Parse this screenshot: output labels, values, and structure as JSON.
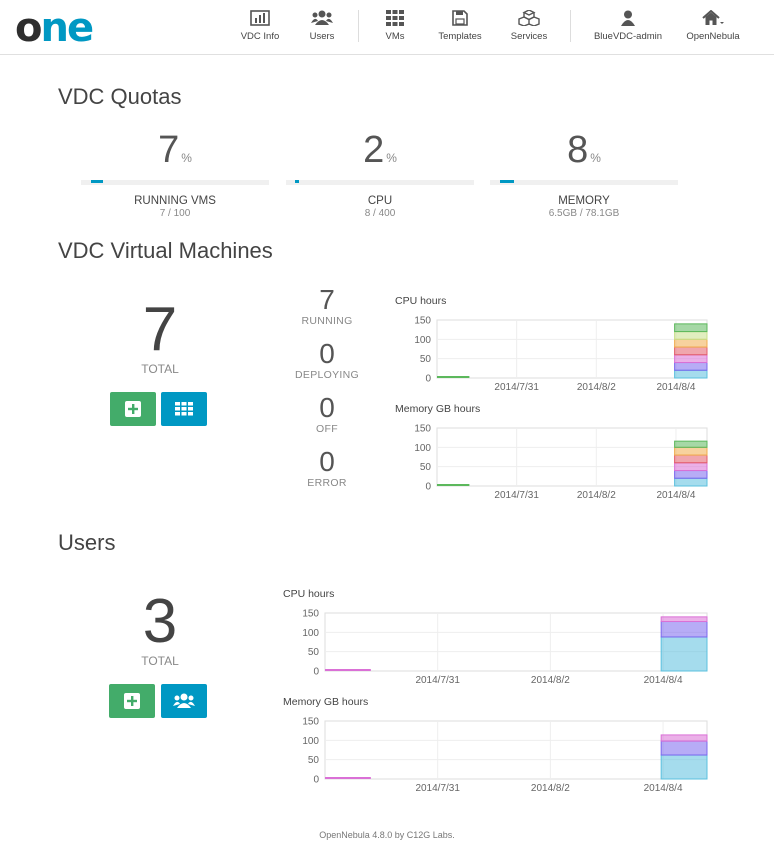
{
  "header": {
    "logo_o": "o",
    "logo_ne": "ne",
    "nav": [
      {
        "label": "VDC Info",
        "icon": "bar-chart-icon"
      },
      {
        "label": "Users",
        "icon": "users-icon"
      },
      {
        "label": "VMs",
        "icon": "grid-icon"
      },
      {
        "label": "Templates",
        "icon": "save-icon"
      },
      {
        "label": "Services",
        "icon": "cubes-icon"
      },
      {
        "label": "BlueVDC-admin",
        "icon": "user-icon"
      },
      {
        "label": "OpenNebula",
        "icon": "home-icon"
      }
    ]
  },
  "quotas": {
    "title": "VDC Quotas",
    "items": [
      {
        "value": "7",
        "unit": "%",
        "label": "RUNNING VMS",
        "detail": "7 / 100",
        "fraction": 0.07
      },
      {
        "value": "2",
        "unit": "%",
        "label": "CPU",
        "detail": "8 / 400",
        "fraction": 0.02
      },
      {
        "value": "8",
        "unit": "%",
        "label": "MEMORY",
        "detail": "6.5GB / 78.1GB",
        "fraction": 0.08
      }
    ]
  },
  "vms": {
    "title": "VDC Virtual Machines",
    "total": "7",
    "total_label": "TOTAL",
    "states": [
      {
        "count": "7",
        "label": "RUNNING"
      },
      {
        "count": "0",
        "label": "DEPLOYING"
      },
      {
        "count": "0",
        "label": "OFF"
      },
      {
        "count": "0",
        "label": "ERROR"
      }
    ],
    "cpu_chart_title": "CPU hours",
    "mem_chart_title": "Memory GB hours"
  },
  "users": {
    "title": "Users",
    "total": "3",
    "total_label": "TOTAL",
    "cpu_chart_title": "CPU hours",
    "mem_chart_title": "Memory GB hours"
  },
  "footer": "OpenNebula 4.8.0 by C12G Labs.",
  "colors": {
    "accent": "#0098c3",
    "green": "#43ac6a"
  },
  "chart_data": [
    {
      "type": "area",
      "title": "CPU hours",
      "x": [
        "2014/7/31",
        "2014/8/2",
        "2014/8/4"
      ],
      "yticks": [
        0,
        50,
        100,
        150
      ],
      "ylim": [
        0,
        150
      ],
      "stacked": true,
      "series": [
        {
          "color": "#5bc0de",
          "values": [
            0,
            0,
            20
          ]
        },
        {
          "color": "#7b68ee",
          "values": [
            0,
            0,
            20
          ]
        },
        {
          "color": "#da70d6",
          "values": [
            0,
            0,
            20
          ]
        },
        {
          "color": "#e35d6a",
          "values": [
            0,
            0,
            20
          ]
        },
        {
          "color": "#f0ad4e",
          "values": [
            0,
            0,
            20
          ]
        },
        {
          "color": "#c8e08a",
          "values": [
            0,
            0,
            20
          ]
        },
        {
          "color": "#5cb85c",
          "values": [
            0,
            0,
            20
          ]
        }
      ]
    },
    {
      "type": "area",
      "title": "Memory GB hours",
      "x": [
        "2014/7/31",
        "2014/8/2",
        "2014/8/4"
      ],
      "yticks": [
        0,
        50,
        100,
        150
      ],
      "ylim": [
        0,
        150
      ],
      "stacked": true,
      "series": [
        {
          "color": "#5bc0de",
          "values": [
            0,
            0,
            20
          ]
        },
        {
          "color": "#7b68ee",
          "values": [
            0,
            0,
            20
          ]
        },
        {
          "color": "#da70d6",
          "values": [
            0,
            0,
            20
          ]
        },
        {
          "color": "#e35d6a",
          "values": [
            0,
            0,
            20
          ]
        },
        {
          "color": "#f0ad4e",
          "values": [
            0,
            0,
            20
          ]
        },
        {
          "color": "#5cb85c",
          "values": [
            0,
            0,
            16
          ]
        }
      ]
    },
    {
      "type": "area",
      "title": "CPU hours",
      "x": [
        "2014/7/31",
        "2014/8/2",
        "2014/8/4"
      ],
      "yticks": [
        0,
        50,
        100,
        150
      ],
      "ylim": [
        0,
        150
      ],
      "stacked": true,
      "series": [
        {
          "color": "#5bc0de",
          "values": [
            0,
            0,
            88
          ]
        },
        {
          "color": "#7b68ee",
          "values": [
            0,
            0,
            40
          ]
        },
        {
          "color": "#da70d6",
          "values": [
            0,
            0,
            12
          ]
        }
      ]
    },
    {
      "type": "area",
      "title": "Memory GB hours",
      "x": [
        "2014/7/31",
        "2014/8/2",
        "2014/8/4"
      ],
      "yticks": [
        0,
        50,
        100,
        150
      ],
      "ylim": [
        0,
        150
      ],
      "stacked": true,
      "series": [
        {
          "color": "#5bc0de",
          "values": [
            0,
            0,
            62
          ]
        },
        {
          "color": "#7b68ee",
          "values": [
            0,
            0,
            36
          ]
        },
        {
          "color": "#da70d6",
          "values": [
            0,
            0,
            16
          ]
        }
      ]
    }
  ]
}
